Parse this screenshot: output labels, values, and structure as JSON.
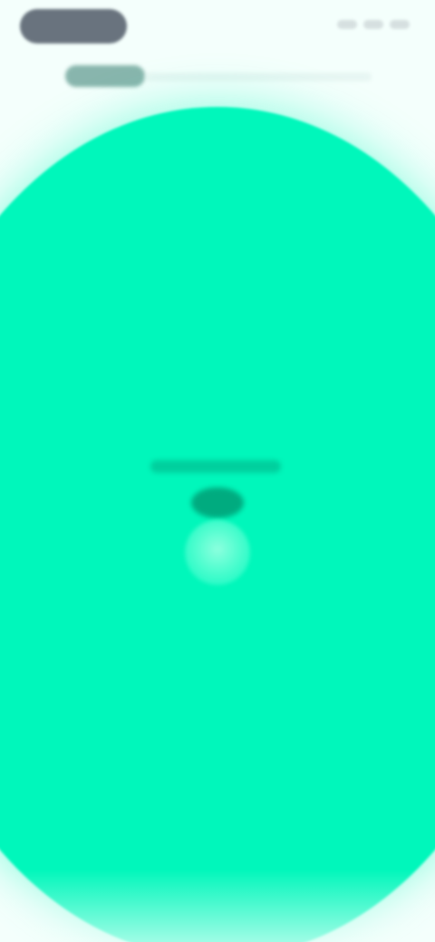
{
  "status_bar": {
    "left_indicator_icon": "status-pill-icon",
    "right_indicator_icons": [
      "signal-icon",
      "wifi-icon",
      "battery-icon"
    ]
  },
  "header": {
    "title_icon": "blurred-title-icon",
    "subtitle_icon": "blurred-subtitle-icon"
  },
  "main": {
    "background_color": "#00f7bb",
    "accent_color": "#00966f",
    "center_control_icon": "circle-control-icon",
    "center_mark_icon": "dark-mark-icon"
  },
  "colors": {
    "page_background": "#f4fffc",
    "status_pill": "#4b5563",
    "title_blur": "#4f8f83"
  }
}
